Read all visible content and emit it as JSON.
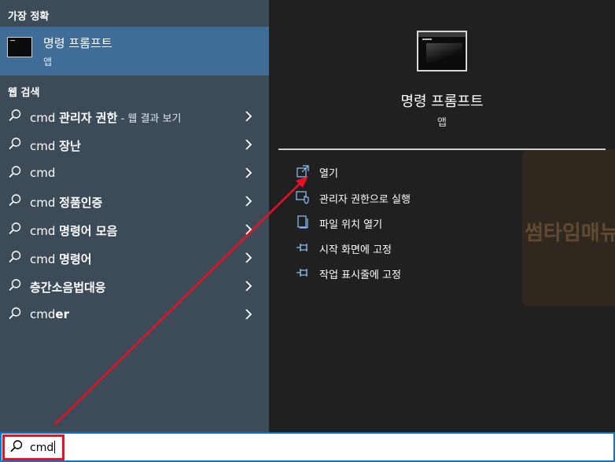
{
  "left_panel": {
    "best_match_header": "가장 정확",
    "best_match": {
      "title": "명령 프롬프트",
      "subtitle": "앱"
    },
    "web_search_header": "웹 검색",
    "web_results": [
      {
        "prefix": "cmd ",
        "bold": "관리자 권한",
        "suffix": " - 웹 결과 보기"
      },
      {
        "prefix": "cmd ",
        "bold": "장난",
        "suffix": ""
      },
      {
        "prefix": "cmd",
        "bold": "",
        "suffix": ""
      },
      {
        "prefix": "cmd ",
        "bold": "정품인증",
        "suffix": ""
      },
      {
        "prefix": "cmd ",
        "bold": "명령어 모음",
        "suffix": ""
      },
      {
        "prefix": "cmd ",
        "bold": "명령어",
        "suffix": ""
      },
      {
        "prefix": "",
        "bold": "층간소음법대응",
        "suffix": ""
      },
      {
        "prefix": "cmd",
        "bold": "er",
        "suffix": ""
      }
    ]
  },
  "right_panel": {
    "title": "명령 프롬프트",
    "subtitle": "앱",
    "actions": [
      {
        "label": "열기",
        "icon": "open-icon"
      },
      {
        "label": "관리자 권한으로 실행",
        "icon": "shield-icon"
      },
      {
        "label": "파일 위치 열기",
        "icon": "file-location-icon"
      },
      {
        "label": "시작 화면에 고정",
        "icon": "pin-icon"
      },
      {
        "label": "작업 표시줄에 고정",
        "icon": "pin-icon"
      }
    ],
    "watermark_text": "썸타임매뉴얼"
  },
  "search": {
    "query": "cmd"
  },
  "colors": {
    "left_bg": "#3c4b57",
    "selected_bg": "#3f6d97",
    "right_bg": "#202020",
    "search_border": "#0078d7",
    "annotation_red": "#e81123"
  }
}
